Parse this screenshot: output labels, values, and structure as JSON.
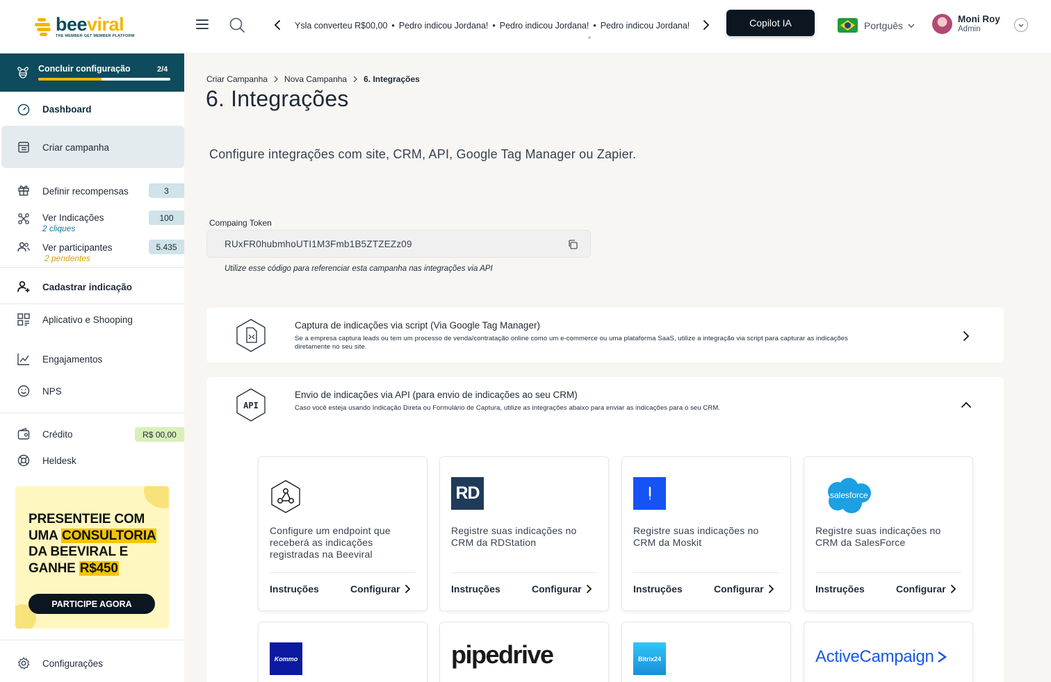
{
  "brand": {
    "name_part1": "bee",
    "name_part2": "viral",
    "tagline": "THE MEMBER GET MEMBER PLATFORM"
  },
  "ticker": [
    "Ysla converteu R$00,00",
    "Pedro indicou Jordana!",
    "Pedro indicou Jordana!",
    "Pedro indicou Jordana!"
  ],
  "header": {
    "copilot_label": "Copilot IA",
    "language": "Portguês",
    "user_name": "Moni Roy",
    "user_role": "Admin"
  },
  "setup": {
    "label": "Concluir configuração",
    "count": "2/4",
    "progress": 0.48
  },
  "sidebar": {
    "dashboard": "Dashboard",
    "criar_campanha": "Criar campanha",
    "recompensas": {
      "label": "Definir recompensas",
      "badge": "3"
    },
    "indicacoes": {
      "label": "Ver Indicações",
      "badge": "100",
      "sub": "2 cliques"
    },
    "participantes": {
      "label": "Ver participantes",
      "badge": "5.435",
      "sub": "2 pendentes"
    },
    "cadastrar": "Cadastrar indicação",
    "aplicativo": "Aplicativo e Shooping",
    "engajamentos": "Engajamentos",
    "nps": "NPS",
    "credito": {
      "label": "Crédito",
      "badge": "R$ 00,00"
    },
    "heldesk": "Heldesk",
    "configuracoes": "Configurações"
  },
  "promo": {
    "line1": "PRESENTEIE COM",
    "line2a": "UMA ",
    "line2b": "CONSULTORIA",
    "line3": "DA BEEVIRAL E",
    "line4a": "GANHE ",
    "line4b": "R$450",
    "button": "PARTICIPE AGORA"
  },
  "breadcrumb": [
    "Criar Campanha",
    "Nova Campanha",
    "6. Integrações"
  ],
  "page": {
    "title": "6. Integrações",
    "description": "Configure integrações com site, CRM, API, Google Tag Manager ou Zapier."
  },
  "token": {
    "label": "Compaing Token",
    "value": "RUxFR0hubmhoUTI1M3Fmb1B5ZTZEZz09",
    "hint": "Utilize esse código para referenciar esta campanha nas integrações via API"
  },
  "panels": {
    "gtm": {
      "title": "Captura de indicações via script (Via Google Tag Manager)",
      "desc": "Se a empresa captura leads ou tem um processo de venda/contratação online como um e-commerce ou uma plataforma SaaS, utilize a integração via script para capturar as indicações diretamente no seu site."
    },
    "api": {
      "title": "Envio de indicações via API (para envio de indicações ao seu CRM)",
      "desc": "Caso você esteja usando Indicação Direta ou Formulário de Captura, utilize as integrações abaixo para enviar as indicações para o seu CRM.",
      "icon_text": "API"
    }
  },
  "cards": [
    {
      "text": "Configure um endpoint que receberá as indicações registradas na Beeviral",
      "instr": "Instruções",
      "config": "Configurar"
    },
    {
      "logo_text": "RD",
      "text": "Registre suas indicações no CRM da RDStation",
      "instr": "Instruções",
      "config": "Configurar"
    },
    {
      "text": "Registre suas indicações no CRM da Moskit",
      "instr": "Instruções",
      "config": "Configurar"
    },
    {
      "logo_text": "salesforce",
      "text": "Registre suas indicações no CRM da SalesForce",
      "instr": "Instruções",
      "config": "Configurar"
    }
  ],
  "cards_row2": {
    "kommo": "Kommo",
    "pipedrive": "pipedrive",
    "bitrix": "Bitrix24",
    "activecampaign": "ActiveCampaign"
  },
  "colors": {
    "primary": "#0e4b5c",
    "accent": "#f5b400",
    "dark": "#0b1620"
  }
}
